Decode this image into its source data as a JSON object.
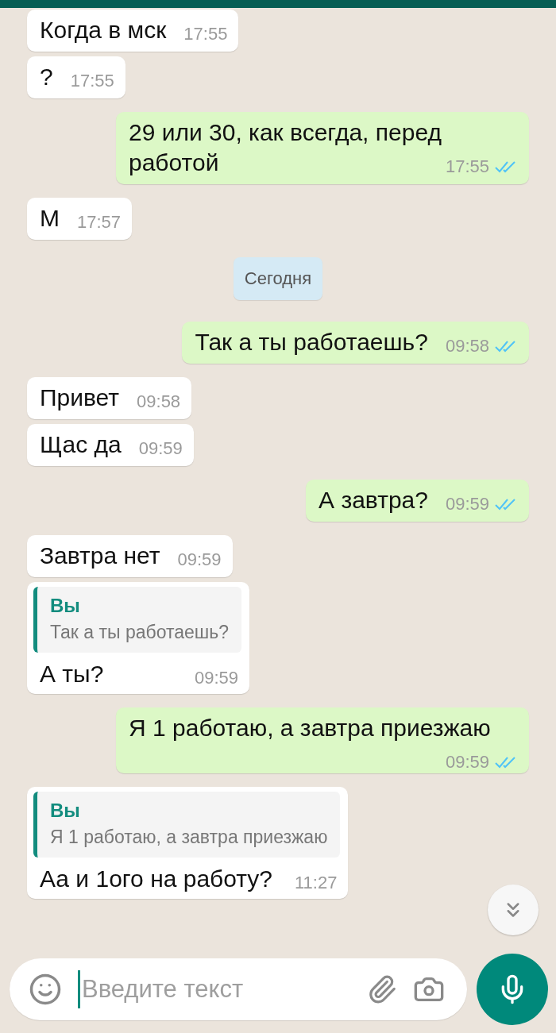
{
  "messages": [
    {
      "kind": "in",
      "text": "Когда в мск",
      "time": "17:55"
    },
    {
      "kind": "in",
      "text": "?",
      "time": "17:55"
    },
    {
      "kind": "out",
      "text": "29 или 30, как всегда, перед работой",
      "time": "17:55",
      "read": true
    },
    {
      "kind": "in",
      "text": "М",
      "time": "17:57"
    },
    {
      "kind": "date",
      "text": "Сегодня"
    },
    {
      "kind": "out",
      "text": "Так а ты работаешь?",
      "time": "09:58",
      "read": true
    },
    {
      "kind": "in",
      "text": "Привет",
      "time": "09:58"
    },
    {
      "kind": "in",
      "text": "Щас да",
      "time": "09:59"
    },
    {
      "kind": "out",
      "text": "А завтра?",
      "time": "09:59",
      "read": true
    },
    {
      "kind": "in",
      "text": "Завтра нет",
      "time": "09:59"
    },
    {
      "kind": "in",
      "text": "А ты?",
      "time": "09:59",
      "reply": {
        "author": "Вы",
        "text": "Так а ты работаешь?"
      }
    },
    {
      "kind": "out",
      "text": "Я 1 работаю, а завтра приезжаю",
      "time": "09:59",
      "read": true
    },
    {
      "kind": "in",
      "text": "Аа и 1ого на работу?",
      "time": "11:27",
      "reply": {
        "author": "Вы",
        "text": "Я 1 работаю, а завтра приезжаю"
      }
    }
  ],
  "composer": {
    "placeholder": "Введите текст"
  }
}
